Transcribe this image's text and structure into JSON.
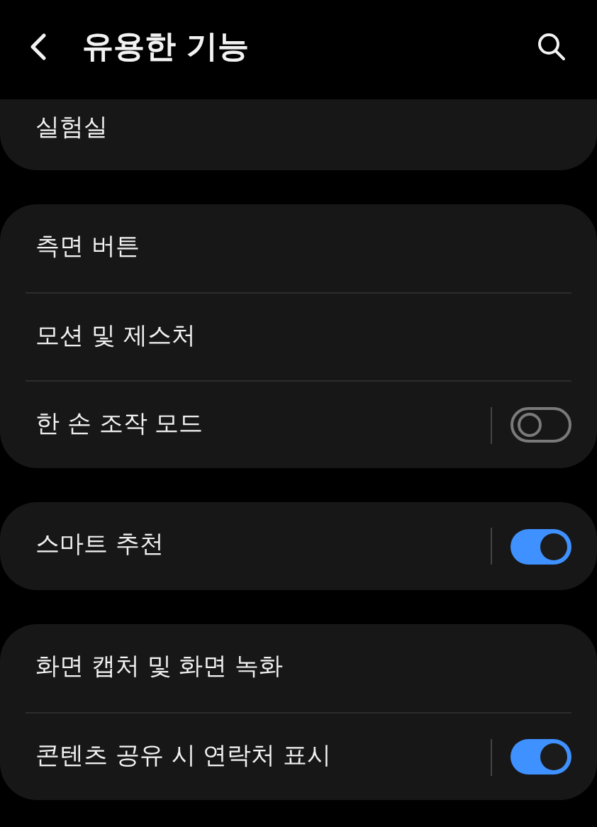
{
  "header": {
    "title": "유용한 기능"
  },
  "sections": [
    {
      "items": [
        {
          "label": "실험실",
          "kind": "link"
        }
      ]
    },
    {
      "items": [
        {
          "label": "측면 버튼",
          "kind": "link"
        },
        {
          "label": "모션 및 제스처",
          "kind": "link"
        },
        {
          "label": "한 손 조작 모드",
          "kind": "toggle",
          "on": false
        }
      ]
    },
    {
      "items": [
        {
          "label": "스마트 추천",
          "kind": "toggle",
          "on": true
        }
      ]
    },
    {
      "items": [
        {
          "label": "화면 캡처 및 화면 녹화",
          "kind": "link"
        },
        {
          "label": "콘텐츠 공유 시 연락처 표시",
          "kind": "toggle",
          "on": true
        }
      ]
    }
  ]
}
